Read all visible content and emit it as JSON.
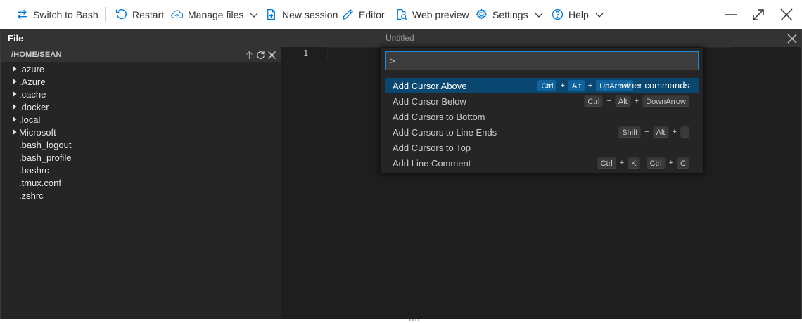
{
  "toolbar": {
    "switch_label": "Switch to Bash",
    "restart_label": "Restart",
    "manage_files_label": "Manage files",
    "new_session_label": "New session",
    "editor_label": "Editor",
    "web_preview_label": "Web preview",
    "settings_label": "Settings",
    "help_label": "Help"
  },
  "menubar": {
    "file_label": "File",
    "editor_title": "Untitled"
  },
  "sidebar": {
    "path": "/HOME/SEAN",
    "items": [
      {
        "label": ".azure",
        "folder": true
      },
      {
        "label": ".Azure",
        "folder": true
      },
      {
        "label": ".cache",
        "folder": true
      },
      {
        "label": ".docker",
        "folder": true
      },
      {
        "label": ".local",
        "folder": true
      },
      {
        "label": "Microsoft",
        "folder": true
      },
      {
        "label": ".bash_logout",
        "folder": false
      },
      {
        "label": ".bash_profile",
        "folder": false
      },
      {
        "label": ".bashrc",
        "folder": false
      },
      {
        "label": ".tmux.conf",
        "folder": false
      },
      {
        "label": ".zshrc",
        "folder": false
      }
    ]
  },
  "editor": {
    "line_number": "1"
  },
  "palette": {
    "input_value": ">",
    "commands": [
      {
        "label": "Add Cursor Above",
        "k1": "Ctrl",
        "k2": "Alt",
        "k3": "UpArrow",
        "extra": "other commands"
      },
      {
        "label": "Add Cursor Below",
        "k1": "Ctrl",
        "k2": "Alt",
        "k3": "DownArrow"
      },
      {
        "label": "Add Cursors to Bottom"
      },
      {
        "label": "Add Cursors to Line Ends",
        "k1": "Shift",
        "k2": "Alt",
        "k3": "I"
      },
      {
        "label": "Add Cursors to Top"
      },
      {
        "label": "Add Line Comment",
        "k1": "Ctrl",
        "k2": "K",
        "k3": "Ctrl",
        "k4": "C"
      }
    ]
  },
  "colors": {
    "accent": "#0078d4",
    "selection": "#094771",
    "editor_bg": "#1e1e1e",
    "sidebar_bg": "#252526"
  }
}
